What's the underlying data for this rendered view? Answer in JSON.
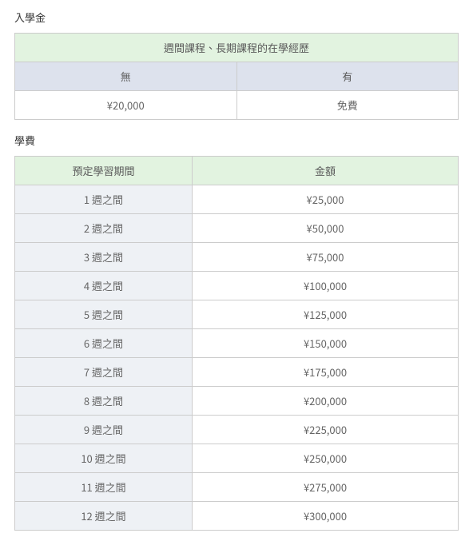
{
  "admission": {
    "section_title": "入學金",
    "span_header": "週間課程、長期課程的在學經歷",
    "sub_headers": [
      "無",
      "有"
    ],
    "values": [
      "¥20,000",
      "免費"
    ]
  },
  "tuition": {
    "section_title": "學費",
    "headers": {
      "period": "預定學習期間",
      "amount": "金額"
    },
    "rows": [
      {
        "period": "1 週之間",
        "amount": "¥25,000"
      },
      {
        "period": "2 週之間",
        "amount": "¥50,000"
      },
      {
        "period": "3 週之間",
        "amount": "¥75,000"
      },
      {
        "period": "4 週之間",
        "amount": "¥100,000"
      },
      {
        "period": "5 週之間",
        "amount": "¥125,000"
      },
      {
        "period": "6 週之間",
        "amount": "¥150,000"
      },
      {
        "period": "7 週之間",
        "amount": "¥175,000"
      },
      {
        "period": "8 週之間",
        "amount": "¥200,000"
      },
      {
        "period": "9 週之間",
        "amount": "¥225,000"
      },
      {
        "period": "10 週之間",
        "amount": "¥250,000"
      },
      {
        "period": "11 週之間",
        "amount": "¥275,000"
      },
      {
        "period": "12 週之間",
        "amount": "¥300,000"
      }
    ]
  }
}
